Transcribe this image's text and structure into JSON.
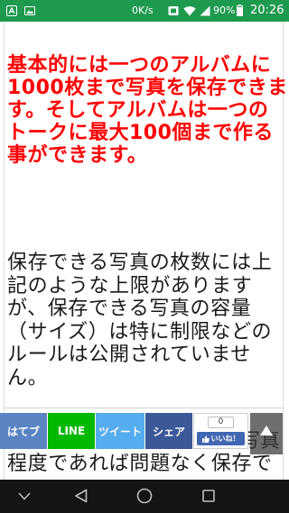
{
  "status_bar": {
    "background": "#1e9a4e",
    "net_speed": "0K/s",
    "battery_percent": "90%",
    "battery_level": 0.9,
    "time": "20:26",
    "left_icons": [
      "app-notification-icon",
      "image-icon"
    ],
    "right_icons": [
      "network-type-icon",
      "wifi-icon",
      "signal-icon",
      "battery-icon"
    ]
  },
  "article": {
    "highlight_color": "#ff0000",
    "highlight_lines": [
      "基本的には一つのアルバムに",
      "1000枚まで写真を保存できま",
      "す。そしてアルバムは一つの",
      "トークに最大100個まで作る",
      "事ができます。"
    ],
    "body_lines": [
      "保存できる写真の枚数には上",
      "記のような上限があります",
      "が、保存できる写真の容量",
      "（サイズ）は特に制限などの",
      "ルールは公開されていませ",
      "ん。"
    ],
    "partial_right": "写真",
    "partial_bottom": "程度であれば問題なく保存で"
  },
  "share_bar": {
    "buttons": [
      {
        "label": "はてブ",
        "color": "#5a84c4"
      },
      {
        "label": "LINE",
        "color": "#00b900"
      },
      {
        "label": "ツイート",
        "color": "#55acee"
      },
      {
        "label": "シェア",
        "color": "#3b5998"
      }
    ],
    "like_count": "0",
    "like_label": "いいね！",
    "like_color": "#4267b2",
    "scroll_top_icon": "up-arrow-icon"
  },
  "nav_bar": {
    "background": "#141414",
    "icons": [
      "chevron-down-icon",
      "back-icon",
      "home-icon",
      "recent-apps-icon"
    ]
  }
}
